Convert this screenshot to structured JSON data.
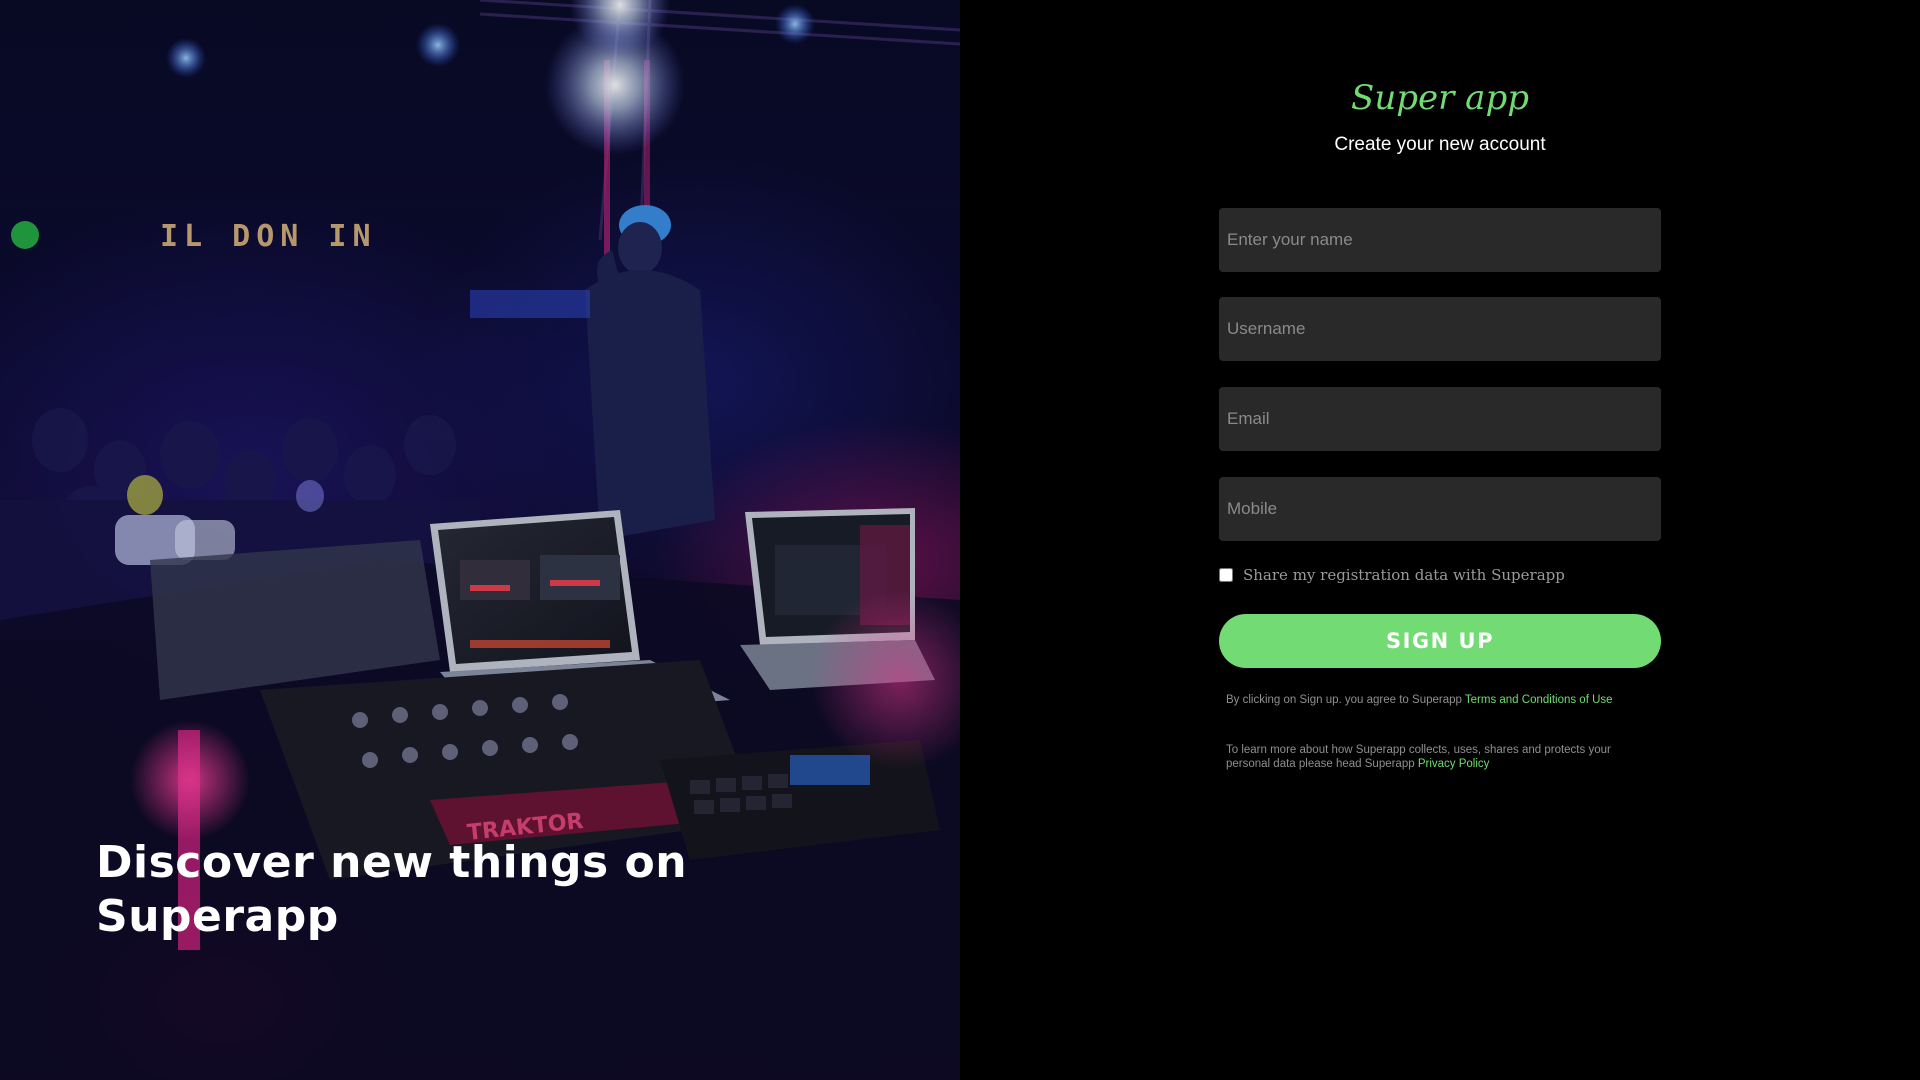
{
  "hero": {
    "stage_sign": "IL DON IN",
    "equipment_label": "TRAKTOR",
    "heading": "Discover new things on Superapp"
  },
  "form": {
    "brand": "Super app",
    "subtitle": "Create your new account",
    "name_placeholder": "Enter your name",
    "username_placeholder": "Username",
    "email_placeholder": "Email",
    "mobile_placeholder": "Mobile",
    "share_label": "Share my registration data with Superapp",
    "share_checked": false,
    "signup_label": "SIGN UP",
    "terms_prefix": "By clicking on Sign up. you agree to Superapp ",
    "terms_link": "Terms and Conditions of Use",
    "privacy_prefix": "To learn more about how Superapp collects, uses, shares and protects your personal data please head Superapp ",
    "privacy_link": "Privacy Policy"
  },
  "colors": {
    "accent": "#72db73",
    "background": "#000000",
    "field_bg": "#292929"
  }
}
